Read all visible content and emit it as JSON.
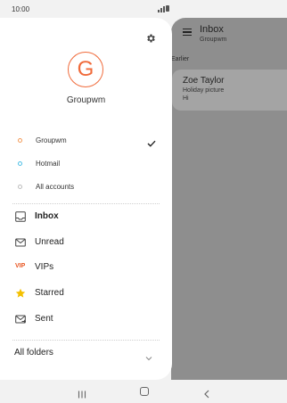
{
  "status_bar": {
    "time": "10:00"
  },
  "mail_list": {
    "title": "Inbox",
    "subtitle": "Groupwm",
    "section": "Earlier",
    "items": [
      {
        "sender": "Zoe Taylor",
        "subject": "Holiday picture",
        "preview": "Hi"
      }
    ]
  },
  "drawer": {
    "avatar_letter": "G",
    "account_name": "Groupwm",
    "accounts": [
      {
        "label": "Groupwm",
        "color": "#f39a58",
        "selected": true
      },
      {
        "label": "Hotmail",
        "color": "#4dbfe6",
        "selected": false
      },
      {
        "label": "All accounts",
        "color": "#bdbdbd",
        "selected": false
      }
    ],
    "folders": [
      {
        "label": "Inbox",
        "icon": "inbox-icon",
        "active": true
      },
      {
        "label": "Unread",
        "icon": "envelope-icon",
        "active": false
      },
      {
        "label": "VIPs",
        "icon": "vip-icon",
        "icon_text": "VIP",
        "active": false
      },
      {
        "label": "Starred",
        "icon": "star-icon",
        "active": false
      },
      {
        "label": "Sent",
        "icon": "sent-icon",
        "active": false
      }
    ],
    "all_folders_label": "All folders"
  },
  "colors": {
    "accent": "#f06a3a",
    "star": "#f4c000",
    "vip": "#e8541f"
  }
}
